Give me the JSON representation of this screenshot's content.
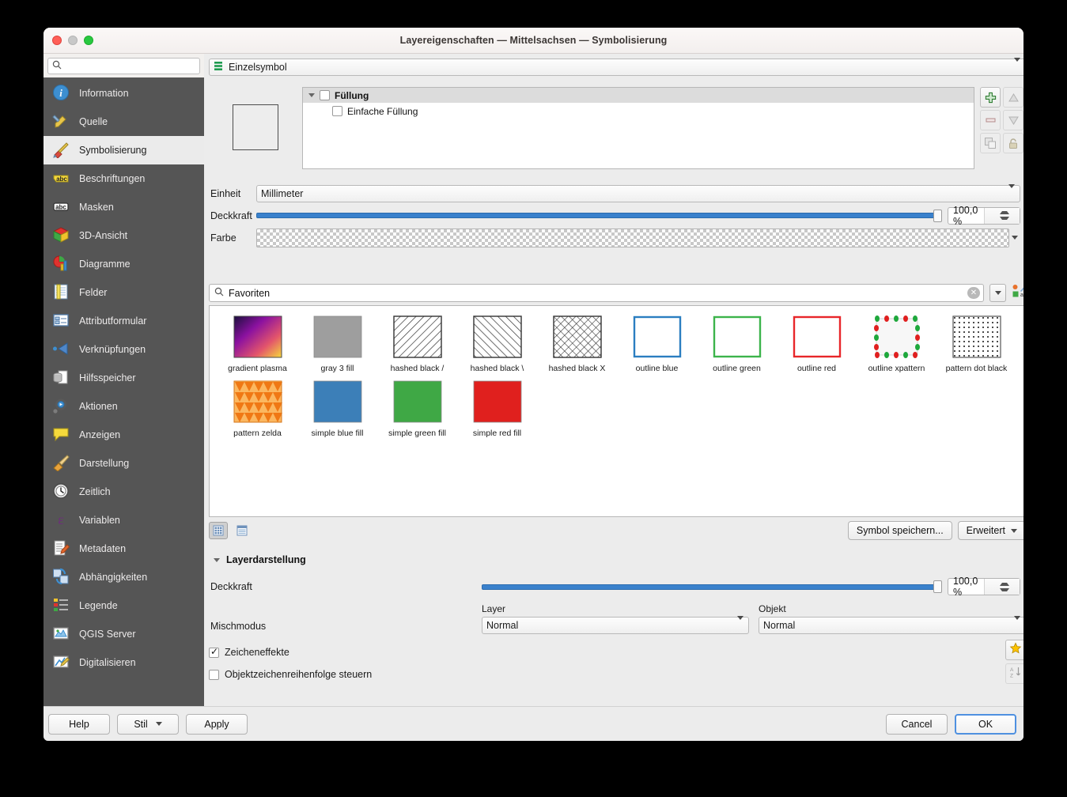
{
  "window": {
    "title": "Layereigenschaften — Mittelsachsen — Symbolisierung"
  },
  "sidebar": {
    "search_placeholder": "",
    "search_value": "",
    "items": [
      {
        "label": "Information",
        "icon": "information-icon",
        "active": false
      },
      {
        "label": "Quelle",
        "icon": "source-icon",
        "active": false
      },
      {
        "label": "Symbolisierung",
        "icon": "brush-icon",
        "active": true
      },
      {
        "label": "Beschriftungen",
        "icon": "labels-abc-icon",
        "active": false
      },
      {
        "label": "Masken",
        "icon": "masks-abc-icon",
        "active": false
      },
      {
        "label": "3D-Ansicht",
        "icon": "cube-3d-icon",
        "active": false
      },
      {
        "label": "Diagramme",
        "icon": "charts-icon",
        "active": false
      },
      {
        "label": "Felder",
        "icon": "fields-table-icon",
        "active": false
      },
      {
        "label": "Attributformular",
        "icon": "attribute-form-icon",
        "active": false
      },
      {
        "label": "Verknüpfungen",
        "icon": "joins-icon",
        "active": false
      },
      {
        "label": "Hilfsspeicher",
        "icon": "auxiliary-storage-icon",
        "active": false
      },
      {
        "label": "Aktionen",
        "icon": "actions-gear-icon",
        "active": false
      },
      {
        "label": "Anzeigen",
        "icon": "display-balloon-icon",
        "active": false
      },
      {
        "label": "Darstellung",
        "icon": "rendering-broom-icon",
        "active": false
      },
      {
        "label": "Zeitlich",
        "icon": "temporal-clock-icon",
        "active": false
      },
      {
        "label": "Variablen",
        "icon": "variables-epsilon-icon",
        "active": false
      },
      {
        "label": "Metadaten",
        "icon": "metadata-pencil-icon",
        "active": false
      },
      {
        "label": "Abhängigkeiten",
        "icon": "dependencies-icon",
        "active": false
      },
      {
        "label": "Legende",
        "icon": "legend-icon",
        "active": false
      },
      {
        "label": "QGIS Server",
        "icon": "qgis-server-icon",
        "active": false
      },
      {
        "label": "Digitalisieren",
        "icon": "digitizing-icon",
        "active": false
      }
    ]
  },
  "renderer": {
    "selected": "Einzelsymbol",
    "icon": "single-symbol-icon"
  },
  "symbol_tree": {
    "parent": {
      "label": "Füllung",
      "checked": false
    },
    "child": {
      "label": "Einfache Füllung",
      "checked": false
    }
  },
  "layer_tools": [
    {
      "name": "add-symbol-layer-button",
      "icon": "plus-green-icon",
      "enabled": true
    },
    {
      "name": "move-up-button",
      "icon": "triangle-up-icon",
      "enabled": false
    },
    {
      "name": "remove-symbol-layer-button",
      "icon": "minus-icon",
      "enabled": false
    },
    {
      "name": "move-down-button",
      "icon": "triangle-down-icon",
      "enabled": false
    },
    {
      "name": "duplicate-button",
      "icon": "copy-icon",
      "enabled": false
    },
    {
      "name": "lock-button",
      "icon": "lock-icon",
      "enabled": false
    }
  ],
  "symbol_props": {
    "unit_label": "Einheit",
    "unit_value": "Millimeter",
    "opacity_label": "Deckkraft",
    "opacity_value": "100,0 %",
    "opacity_percent": 100,
    "color_label": "Farbe",
    "color_value": "transparent"
  },
  "gallery": {
    "search_value": "Favoriten",
    "clear_icon": "clear-icon",
    "dropdown_icon": "chevron-down-icon",
    "style_manager_icon": "style-manager-icon",
    "items": [
      {
        "label": "gradient  plasma",
        "type": "gradient"
      },
      {
        "label": "gray 3 fill",
        "type": "solid",
        "color": "#9e9e9e"
      },
      {
        "label": "hashed black /",
        "type": "hatch-fwd"
      },
      {
        "label": "hashed black \\",
        "type": "hatch-back"
      },
      {
        "label": "hashed black X",
        "type": "hatch-cross"
      },
      {
        "label": "outline blue",
        "type": "outline",
        "color": "#2b7ec1"
      },
      {
        "label": "outline green",
        "type": "outline",
        "color": "#3cb44b"
      },
      {
        "label": "outline red",
        "type": "outline",
        "color": "#e8262a"
      },
      {
        "label": "outline xpattern",
        "type": "xpattern"
      },
      {
        "label": "pattern dot black",
        "type": "dots"
      },
      {
        "label": "pattern zelda",
        "type": "zelda"
      },
      {
        "label": "simple blue fill",
        "type": "solid",
        "color": "#3c7fb8"
      },
      {
        "label": "simple green fill",
        "type": "solid",
        "color": "#3fa845"
      },
      {
        "label": "simple red fill",
        "type": "solid",
        "color": "#e0201e"
      }
    ],
    "view_grid_icon": "grid-view-icon",
    "view_list_icon": "list-view-icon",
    "save_symbol_label": "Symbol speichern...",
    "advanced_label": "Erweitert"
  },
  "layer_rendering": {
    "section_label": "Layerdarstellung",
    "opacity_label": "Deckkraft",
    "opacity_value": "100,0 %",
    "opacity_percent": 100,
    "blend_label": "Mischmodus",
    "layer_blend_title": "Layer",
    "layer_blend_value": "Normal",
    "feature_blend_title": "Objekt",
    "feature_blend_value": "Normal",
    "draw_effects_label": "Zeicheneffekte",
    "draw_effects_checked": true,
    "feature_order_label": "Objektzeichenreihenfolge steuern",
    "feature_order_checked": false,
    "effects_icon": "star-effects-icon",
    "sort_icon": "sort-az-icon"
  },
  "footer": {
    "help_label": "Help",
    "style_label": "Stil",
    "apply_label": "Apply",
    "cancel_label": "Cancel",
    "ok_label": "OK"
  },
  "colors": {
    "accent": "#3a81cc",
    "sidebar_bg": "#555555",
    "panel_bg": "#ececec",
    "primary_button_border": "#4e90e0"
  }
}
